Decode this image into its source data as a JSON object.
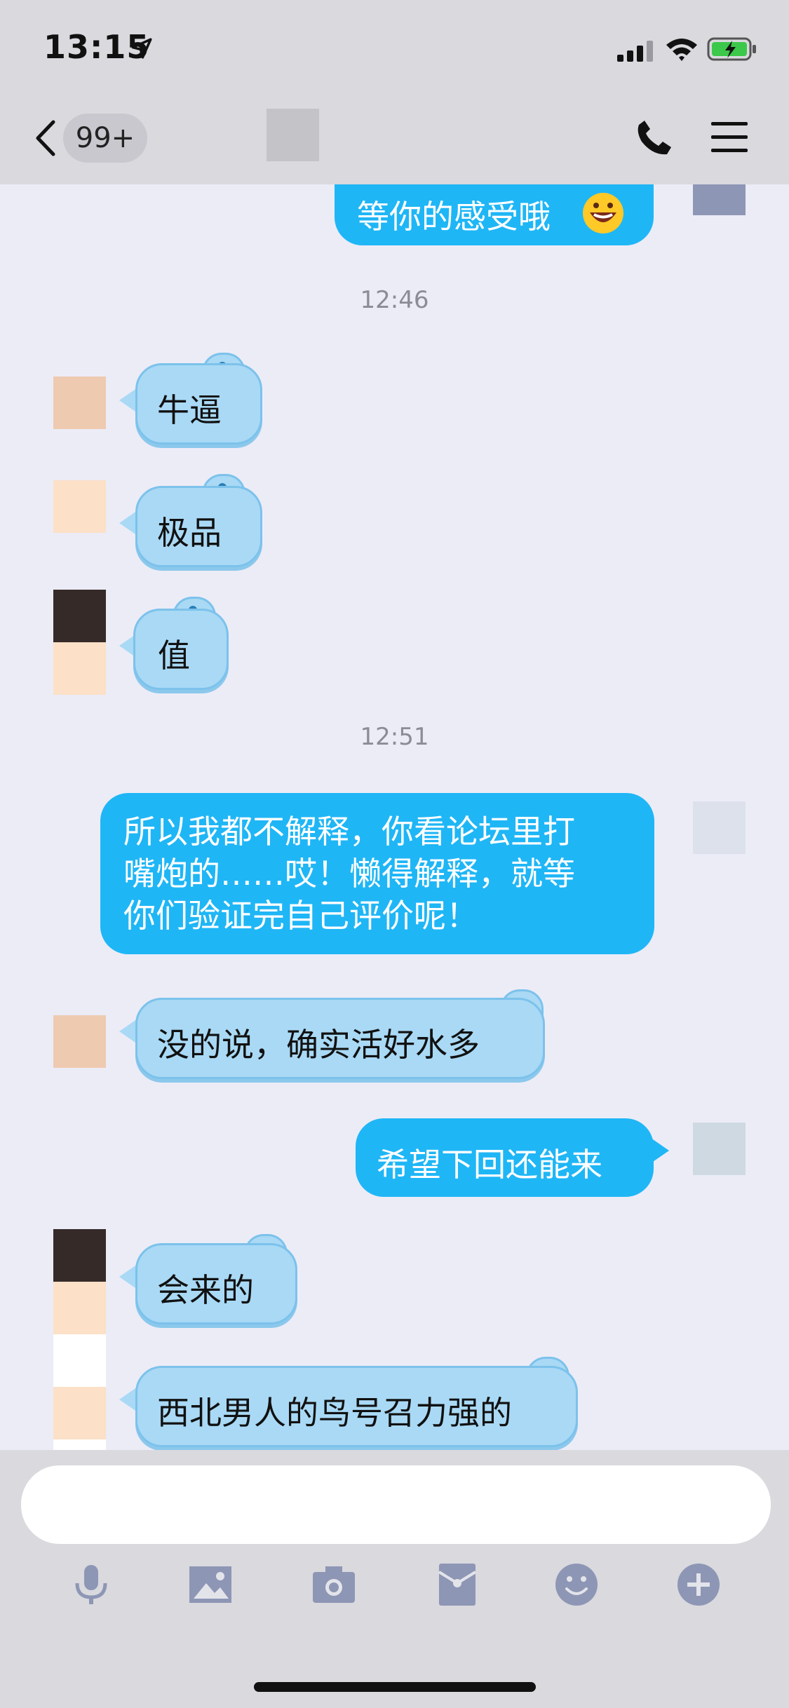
{
  "status_bar": {
    "time": "13:15"
  },
  "header": {
    "unread_count": "99+"
  },
  "messages": {
    "m1": {
      "text": "等你的感受哦"
    },
    "ts1": "12:46",
    "m2": {
      "text": "牛逼"
    },
    "m3": {
      "text": "极品"
    },
    "m4": {
      "text": "值"
    },
    "ts2": "12:51",
    "m5": {
      "lines": [
        "所以我都不解释，你看论坛里打",
        "嘴炮的……哎！懒得解释，就等",
        "你们验证完自己评价呢！"
      ]
    },
    "m6": {
      "text": "没的说，确实活好水多"
    },
    "m7": {
      "text": "希望下回还能来"
    },
    "m8": {
      "text": "会来的"
    },
    "m9": {
      "text": "西北男人的鸟号召力强的"
    }
  },
  "toolbar": {
    "icons": [
      "microphone-icon",
      "image-icon",
      "camera-icon",
      "red-packet-icon",
      "emoji-icon",
      "plus-icon"
    ]
  },
  "colors": {
    "outgoing_bubble": "#1FB6F6",
    "incoming_bubble": "#A9D9F5",
    "chat_background": "#ECECF7",
    "bar_background": "#D9D9DE"
  }
}
